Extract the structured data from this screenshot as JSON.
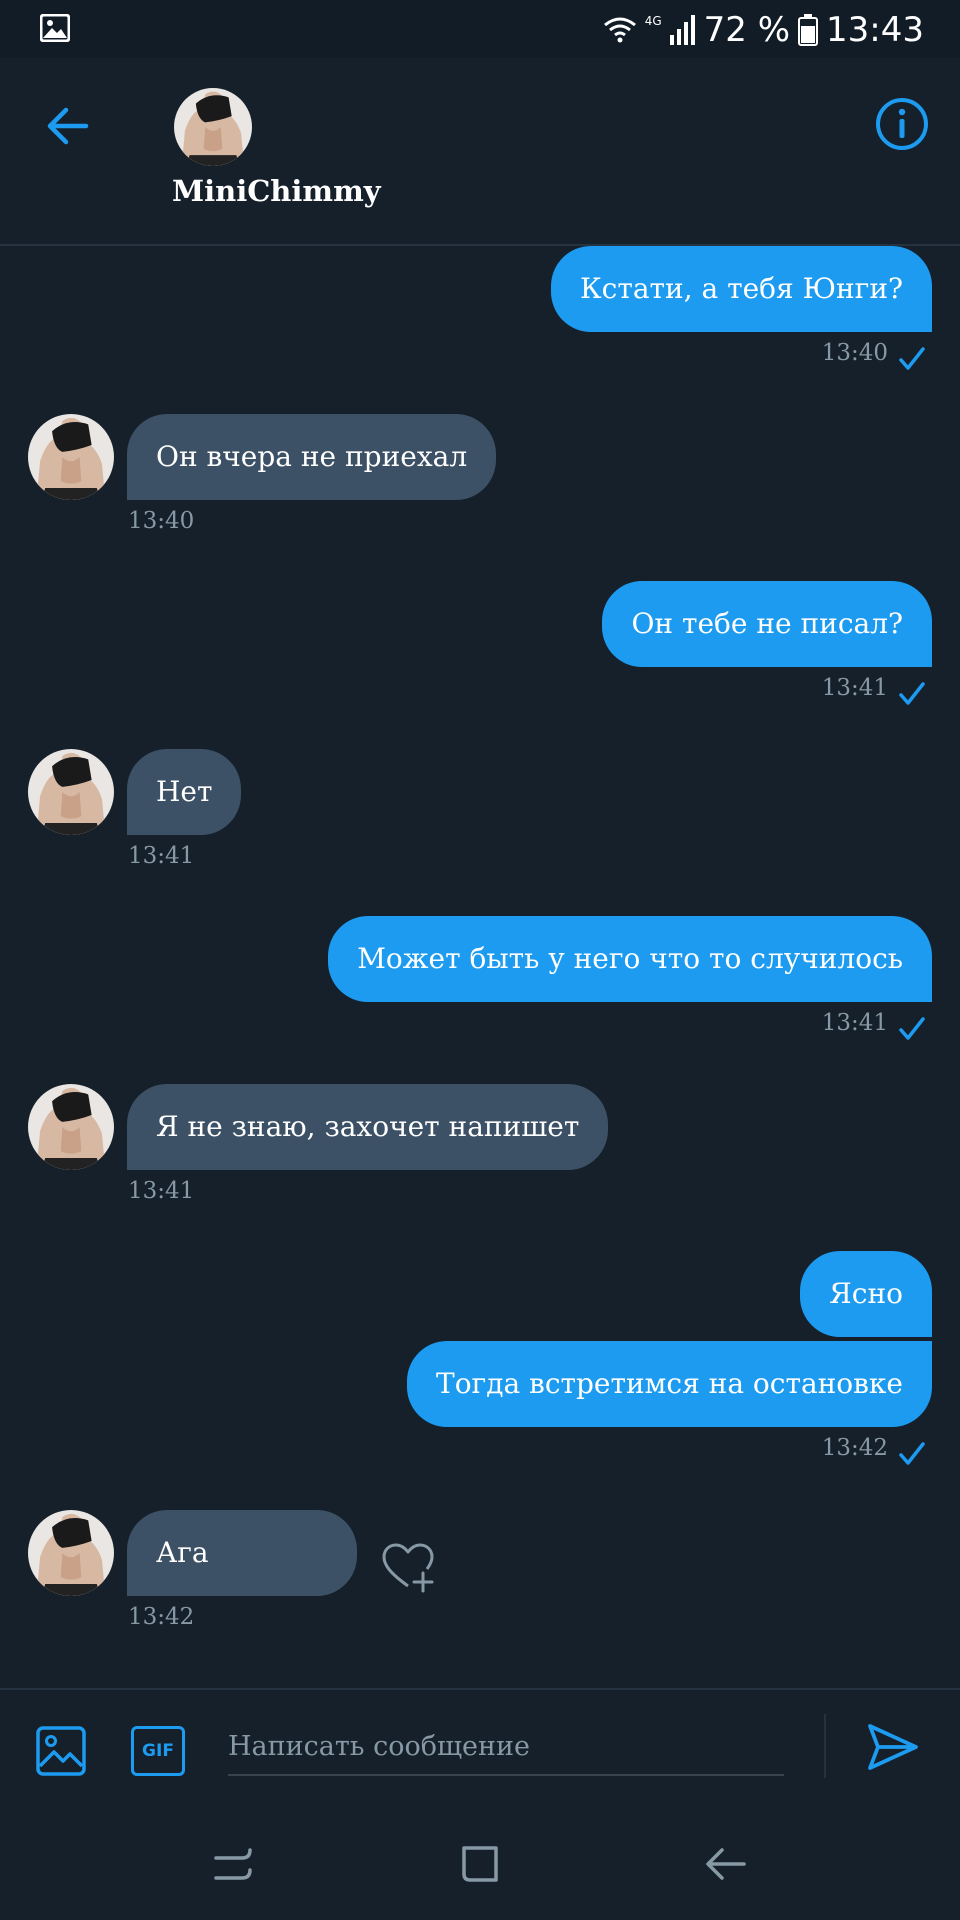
{
  "status_bar": {
    "network": "4G",
    "battery": "72 %",
    "time": "13:43"
  },
  "header": {
    "contact_name": "MiniChimmy"
  },
  "messages": [
    {
      "dir": "out",
      "text": "Кстати, а тебя Юнги?",
      "time": "13:40"
    },
    {
      "dir": "in",
      "text": "Он вчера не приехал",
      "time": "13:40"
    },
    {
      "dir": "out",
      "text": "Он тебе не писал?",
      "time": "13:41"
    },
    {
      "dir": "in",
      "text": "Нет",
      "time": "13:41"
    },
    {
      "dir": "out",
      "text": "Может быть у него что то случилось",
      "time": "13:41"
    },
    {
      "dir": "in",
      "text": "Я не знаю, захочет напишет",
      "time": "13:41"
    },
    {
      "dir": "out",
      "text": "Ясно"
    },
    {
      "dir": "out",
      "text": "Тогда встретимся на остановке",
      "time": "13:42"
    },
    {
      "dir": "in",
      "text": "Ага",
      "time": "13:42"
    }
  ],
  "composer": {
    "placeholder": "Написать сообщение",
    "gif_label": "GIF"
  },
  "colors": {
    "background": "#15202b",
    "accent": "#1d9bf0",
    "incoming_bubble": "#3d5166",
    "muted_text": "#8899a6"
  },
  "icons": {
    "back": "arrow-left-icon",
    "info": "info-icon",
    "image": "image-icon",
    "gif": "gif-icon",
    "send": "send-icon",
    "heart": "heart-plus-icon",
    "check": "check-icon"
  }
}
